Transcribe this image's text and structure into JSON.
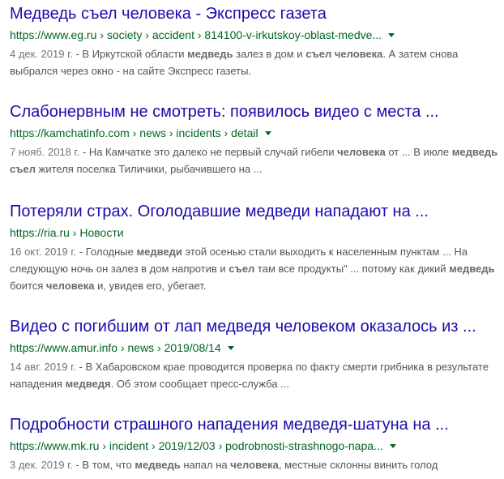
{
  "results": [
    {
      "title": "Медведь съел человека - Экспресс газета",
      "url": "https://www.eg.ru › society › accident › 814100-v-irkutskoy-oblast-medve...",
      "has_menu": true,
      "date": "4 дек. 2019 г.",
      "snippet": [
        [
          " - В Иркутской области ",
          false
        ],
        [
          "медведь",
          true
        ],
        [
          " залез в дом и ",
          false
        ],
        [
          "съел человека",
          true
        ],
        [
          ". А затем снова выбрался через окно - на сайте Экспресс газеты.",
          false
        ]
      ]
    },
    {
      "title": "Слабонервным не смотреть: появилось видео с места ...",
      "url": "https://kamchatinfo.com › news › incidents › detail",
      "has_menu": true,
      "date": "7 нояб. 2018 г.",
      "snippet": [
        [
          " - На Камчатке это далеко не первый случай гибели ",
          false
        ],
        [
          "человека",
          true
        ],
        [
          " от ... В июле ",
          false
        ],
        [
          "медведь съел",
          true
        ],
        [
          " жителя поселка Тиличики, рыбачившего на ...",
          false
        ]
      ]
    },
    {
      "title": "Потеряли страх. Оголодавшие медведи нападают на ...",
      "url": "https://ria.ru › Новости",
      "has_menu": false,
      "date": "16 окт. 2019 г.",
      "snippet": [
        [
          " - Голодные ",
          false
        ],
        [
          "медведи",
          true
        ],
        [
          " этой осенью стали выходить к населенным пунктам ... На следующую ночь он залез в дом напротив и ",
          false
        ],
        [
          "съел",
          true
        ],
        [
          " там все продукты\" ... потому как дикий ",
          false
        ],
        [
          "медведь",
          true
        ],
        [
          " боится ",
          false
        ],
        [
          "человека",
          true
        ],
        [
          " и, увидев его, убегает.",
          false
        ]
      ]
    },
    {
      "title": "Видео с погибшим от лап медведя человеком оказалось из ...",
      "url": "https://www.amur.info › news › 2019/08/14",
      "has_menu": true,
      "date": "14 авг. 2019 г.",
      "snippet": [
        [
          " - В Хабаровском крае проводится проверка по факту смерти грибника в результате нападения ",
          false
        ],
        [
          "медведя",
          true
        ],
        [
          ". Об этом сообщает пресс-служба ...",
          false
        ]
      ]
    },
    {
      "title": "Подробности страшного нападения медведя-шатуна на ...",
      "url": "https://www.mk.ru › incident › 2019/12/03 › podrobnosti-strashnogo-napa...",
      "has_menu": true,
      "date": "3 дек. 2019 г.",
      "snippet": [
        [
          " - В том, что ",
          false
        ],
        [
          "медведь",
          true
        ],
        [
          " напал на ",
          false
        ],
        [
          "человека",
          true
        ],
        [
          ", местные склонны винить голод",
          false
        ]
      ]
    }
  ]
}
